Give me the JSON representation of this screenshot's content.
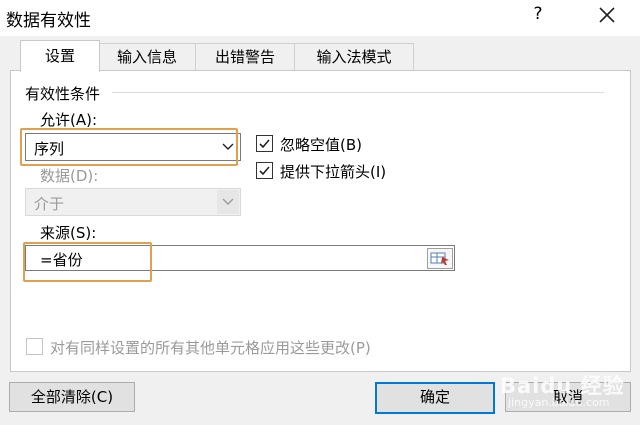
{
  "window": {
    "title": "数据有效性",
    "help": "?"
  },
  "tabs": [
    {
      "label": "设置",
      "active": true
    },
    {
      "label": "输入信息",
      "active": false
    },
    {
      "label": "出错警告",
      "active": false
    },
    {
      "label": "输入法模式",
      "active": false
    }
  ],
  "settings": {
    "group_label": "有效性条件",
    "allow_label": "允许(A):",
    "allow_value": "序列",
    "data_label": "数据(D):",
    "data_value": "介于",
    "ignore_blank_label": "忽略空值(B)",
    "ignore_blank_checked": true,
    "dropdown_label": "提供下拉箭头(I)",
    "dropdown_checked": true,
    "source_label": "来源(S):",
    "source_value": "=省份",
    "apply_all_label": "对有同样设置的所有其他单元格应用这些更改(P)",
    "apply_all_checked": false
  },
  "buttons": {
    "clear_all": "全部清除(C)",
    "ok": "确定",
    "cancel": "取消"
  },
  "watermark": {
    "line1": "Baidu 经验",
    "line2": "jingyan.baidu.com"
  },
  "colors": {
    "highlight": "#e0a050",
    "default_button_border": "#0078d7"
  }
}
